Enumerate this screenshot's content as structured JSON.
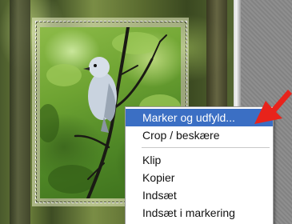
{
  "context_menu": {
    "items": [
      {
        "label": "Marker og udfyld...",
        "highlighted": true
      },
      {
        "label": "Crop / beskære"
      },
      {
        "label": "Klip"
      },
      {
        "label": "Kopier"
      },
      {
        "label": "Indsæt"
      },
      {
        "label": "Indsæt i markering"
      }
    ]
  },
  "colors": {
    "menu_highlight": "#3b6fc4",
    "arrow": "#e8231b"
  },
  "icons": [
    "bird-photo",
    "selection-marquee",
    "red-arrow-pointer"
  ]
}
